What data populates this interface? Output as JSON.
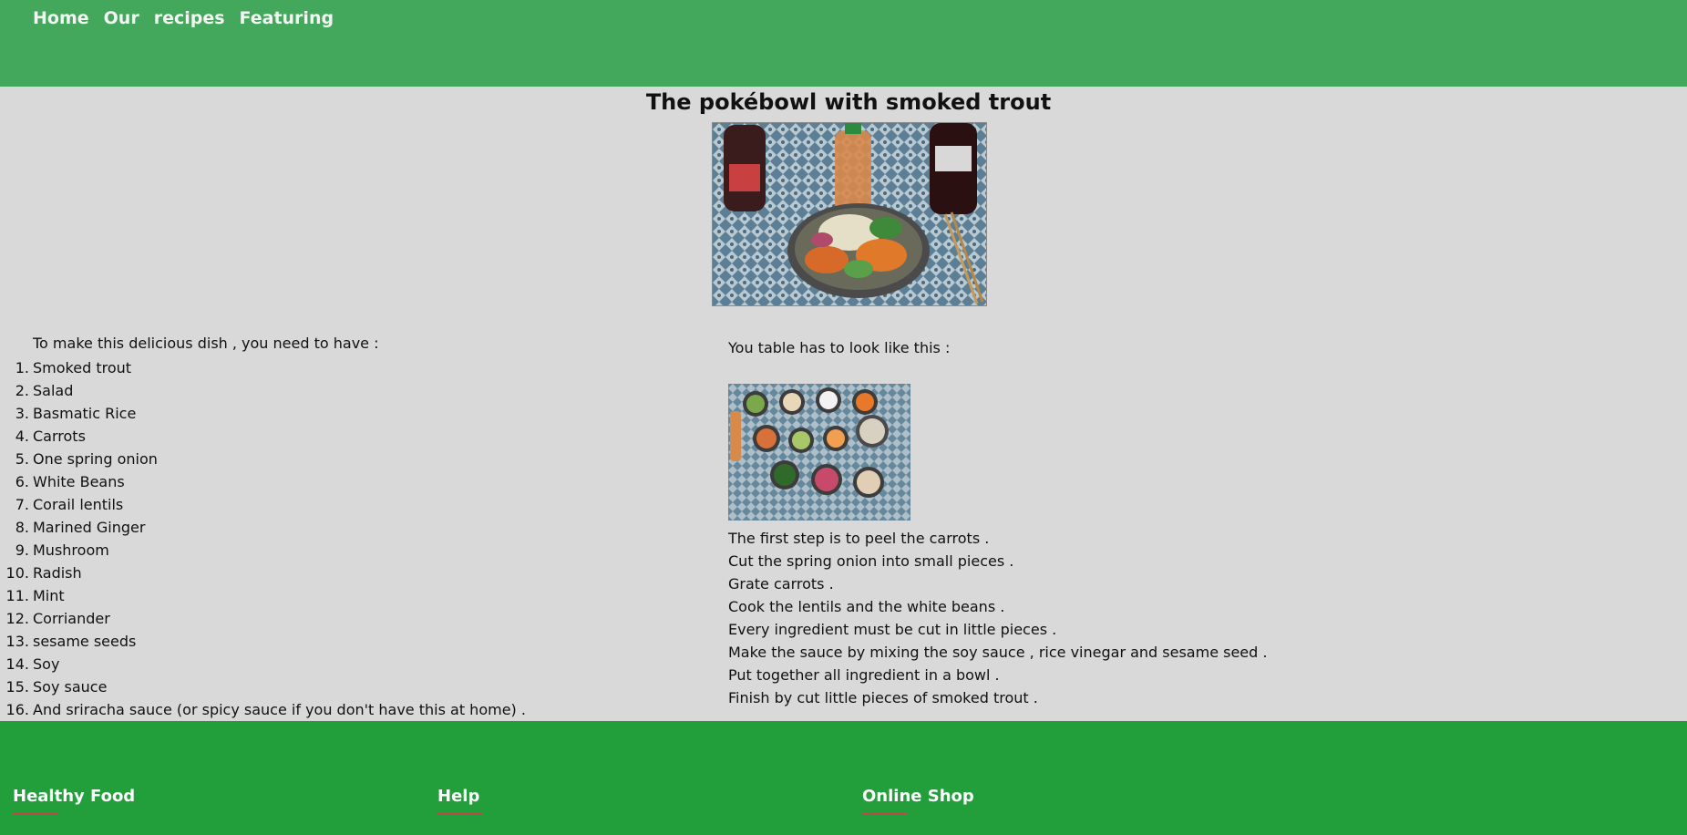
{
  "nav": {
    "items": [
      {
        "label": "Home"
      },
      {
        "label": "Our"
      },
      {
        "label": "recipes"
      },
      {
        "label": "Featuring"
      }
    ]
  },
  "page": {
    "title": "The pokébowl with smoked trout"
  },
  "ingredients": {
    "intro": "To make this delicious dish , you need to have :",
    "items": [
      "Smoked trout",
      "Salad",
      "Basmatic Rice",
      "Carrots",
      "One spring onion",
      "White Beans",
      "Corail lentils",
      "Marined Ginger",
      "Mushroom",
      "Radish",
      "Mint",
      "Corriander",
      "sesame seeds",
      "Soy",
      "Soy sauce",
      "And sriracha sauce (or spicy sauce if you don't have this at home) ."
    ]
  },
  "table": {
    "intro": "You table has to look like this :"
  },
  "steps": [
    "The first step is to peel the carrots .",
    "Cut the spring onion into small pieces .",
    "Grate carrots .",
    "Cook the lentils and the white beans .",
    "Every ingredient must be cut in little pieces .",
    "Make the sauce by mixing the soy sauce , rice vinegar and sesame seed .",
    "Put together all ingredient in a bowl .",
    "Finish by cut little pieces of smoked trout ."
  ],
  "footer": {
    "columns": [
      {
        "title": "Healthy Food"
      },
      {
        "title": "Help"
      },
      {
        "title": "Online Shop"
      }
    ]
  },
  "colors": {
    "header": "#43a85c",
    "footer": "#229e3b",
    "background": "#d9d9d9",
    "underline": "#b84c4c"
  }
}
